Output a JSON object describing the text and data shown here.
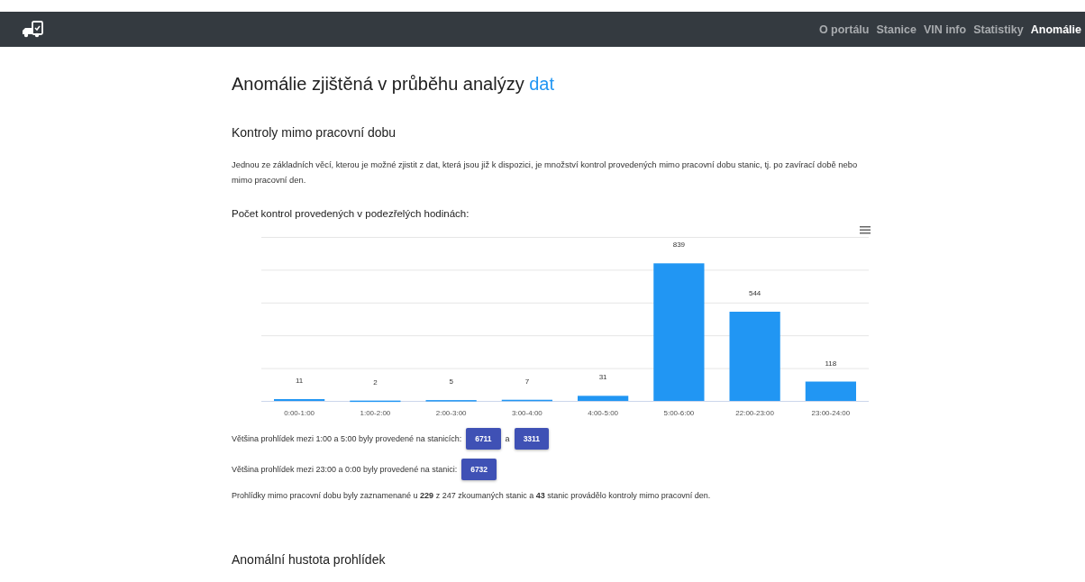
{
  "nav": {
    "items": [
      {
        "label": "O portálu",
        "selected": false
      },
      {
        "label": "Stanice",
        "selected": false
      },
      {
        "label": "VIN info",
        "selected": false
      },
      {
        "label": "Statistiky",
        "selected": false
      },
      {
        "label": "Anomálie",
        "selected": true
      }
    ]
  },
  "title": {
    "text": "Anomálie zjištěná v průběhu analýzy",
    "highlight": "dat"
  },
  "section": {
    "heading": "Kontroly mimo pracovní dobu",
    "paragraph": "Jednou ze základních věcí, kterou je možné zjistit z dat, která jsou již k dispozici, je množství kontrol provedených mimo pracovní dobu stanic, tj. po zavírací době nebo mimo pracovní den.",
    "chart_heading": "Počet kontrol provedených v podezřelých hodinách:",
    "chart_data": {
      "type": "bar",
      "categories": [
        "0:00-1:00",
        "1:00-2:00",
        "2:00-3:00",
        "3:00-4:00",
        "4:00-5:00",
        "5:00-6:00",
        "22:00-23:00",
        "23:00-24:00"
      ],
      "series": [
        {
          "color": "#2196f3",
          "values": [
            11,
            2,
            5,
            7,
            31,
            839,
            544,
            118
          ]
        }
      ],
      "ylim": [
        0,
        1000
      ],
      "data_labels": true
    },
    "findings": [
      {
        "text": "Většina prohlídek mezi 1:00 a 5:00 byly provedené na stanicích:",
        "chips": [
          "6711",
          "3311"
        ],
        "joiner": "a"
      },
      {
        "text": "Většina prohlídek mezi 23:00 a 0:00 byly provedené na stanici:",
        "chips": [
          "6732"
        ]
      }
    ],
    "summary": "Prohlídky mimo pracovní dobu byly zaznamenané u **229** z 247 zkoumaných stanic a **43** stanic provádělo kontroly mimo pracovní den."
  },
  "next_heading": "Anomální hustota prohlídek"
}
